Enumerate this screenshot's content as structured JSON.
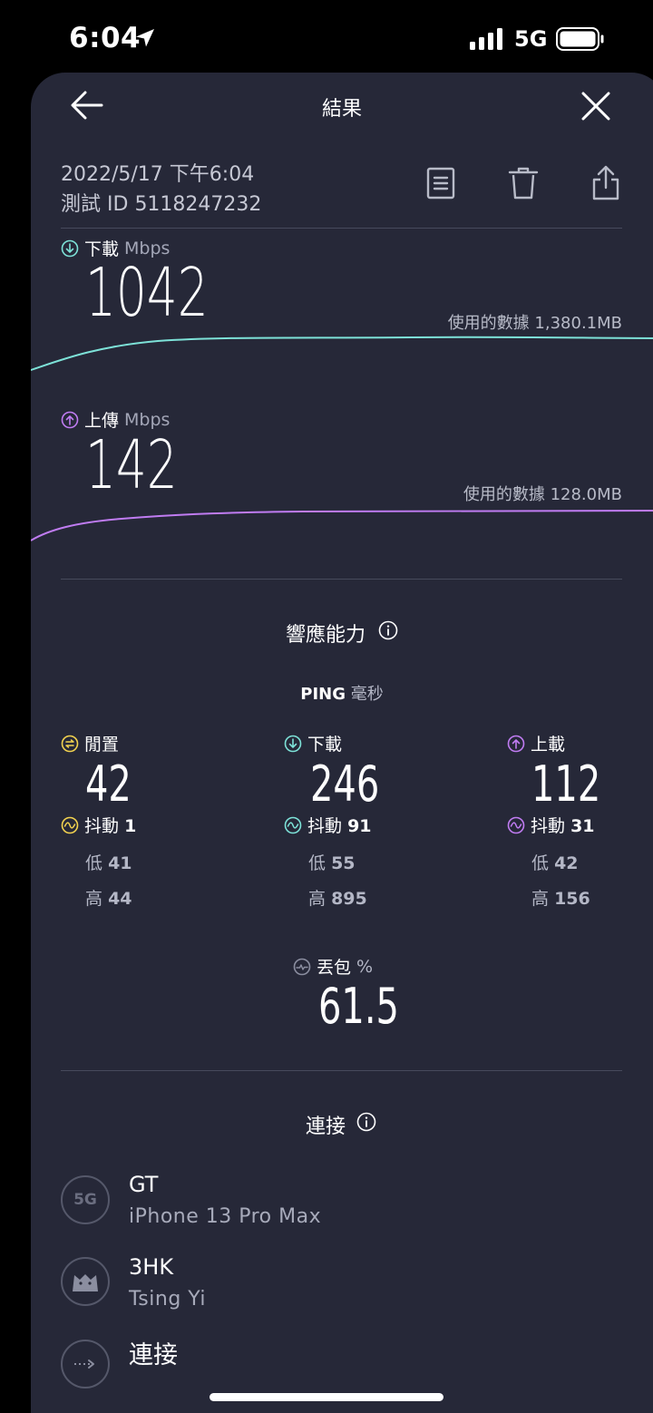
{
  "status": {
    "time": "6:04",
    "network": "5G"
  },
  "header": {
    "title": "結果"
  },
  "meta": {
    "datetime": "2022/5/17 下午6:04",
    "test_id_label": "測試 ID",
    "test_id": "5118247232"
  },
  "download": {
    "label": "下載",
    "unit": "Mbps",
    "value": "1042",
    "data_used": "使用的數據 1,380.1MB"
  },
  "upload": {
    "label": "上傳",
    "unit": "Mbps",
    "value": "142",
    "data_used": "使用的數據 128.0MB"
  },
  "responsiveness": {
    "title": "響應能力",
    "ping_label": "PING",
    "ping_unit": "毫秒",
    "columns": [
      {
        "label": "閒置",
        "value": "42",
        "jitter_label": "抖動",
        "jitter": "1",
        "low_label": "低",
        "low": "41",
        "high_label": "高",
        "high": "44"
      },
      {
        "label": "下載",
        "value": "246",
        "jitter_label": "抖動",
        "jitter": "91",
        "low_label": "低",
        "low": "55",
        "high_label": "高",
        "high": "895"
      },
      {
        "label": "上載",
        "value": "112",
        "jitter_label": "抖動",
        "jitter": "31",
        "low_label": "低",
        "low": "42",
        "high_label": "高",
        "high": "156"
      }
    ],
    "packet_loss_label": "丟包",
    "packet_loss_unit": "%",
    "packet_loss": "61.5"
  },
  "connection": {
    "title": "連接",
    "items": [
      {
        "badge": "5G",
        "title": "GT",
        "subtitle": "iPhone 13 Pro Max"
      },
      {
        "title": "3HK",
        "subtitle": "Tsing Yi"
      },
      {
        "title": "連接"
      }
    ]
  },
  "colors": {
    "download": "#7de2d8",
    "upload": "#c07cf2",
    "idle": "#f2d24f",
    "background": "#262838"
  }
}
